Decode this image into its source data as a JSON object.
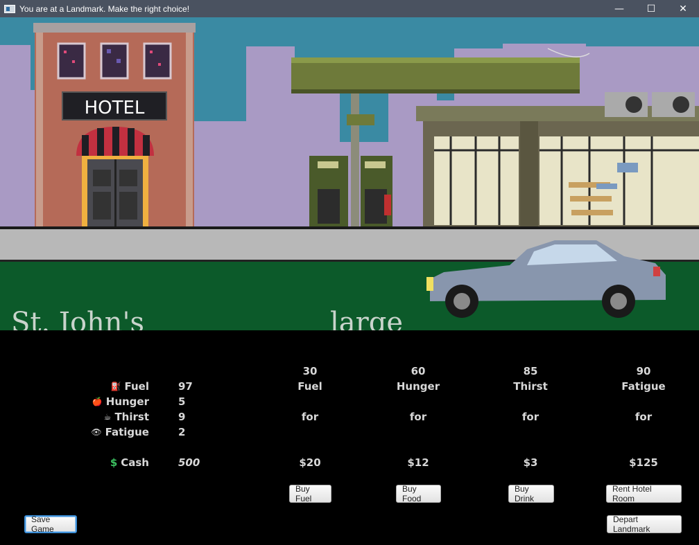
{
  "window": {
    "title": "You are at a Landmark. Make the right choice!",
    "minimize_glyph": "—",
    "maximize_glyph": "☐",
    "close_glyph": "✕"
  },
  "scene": {
    "hotel_sign": "HOTEL",
    "landmark_name": "St. John's",
    "landmark_size": "large"
  },
  "stats": [
    {
      "label": "Fuel",
      "value": "97",
      "icon": "fuel-pump-icon",
      "glyph": "⛽"
    },
    {
      "label": "Hunger",
      "value": "5",
      "icon": "apple-icon",
      "glyph": "🍎"
    },
    {
      "label": "Thirst",
      "value": "9",
      "icon": "cup-icon",
      "glyph": "☕"
    },
    {
      "label": "Fatigue",
      "value": "2",
      "icon": "eye-icon",
      "glyph": "👁"
    }
  ],
  "cash": {
    "label": "Cash",
    "value": "500",
    "icon": "dollar-icon",
    "glyph": "$"
  },
  "shop": [
    {
      "amount": "30",
      "resource": "Fuel",
      "for": "for",
      "price": "$20",
      "button": "Buy Fuel"
    },
    {
      "amount": "60",
      "resource": "Hunger",
      "for": "for",
      "price": "$12",
      "button": "Buy Food"
    },
    {
      "amount": "85",
      "resource": "Thirst",
      "for": "for",
      "price": "$3",
      "button": "Buy Drink"
    },
    {
      "amount": "90",
      "resource": "Fatigue",
      "for": "for",
      "price": "$125",
      "button": "Rent Hotel Room"
    }
  ],
  "actions": {
    "save": "Save Game",
    "depart": "Depart Landmark"
  },
  "colors": {
    "titlebar": "#4a5260",
    "sky": "#3a8aa3",
    "banner": "#0c5a2a",
    "panel": "#000000"
  }
}
